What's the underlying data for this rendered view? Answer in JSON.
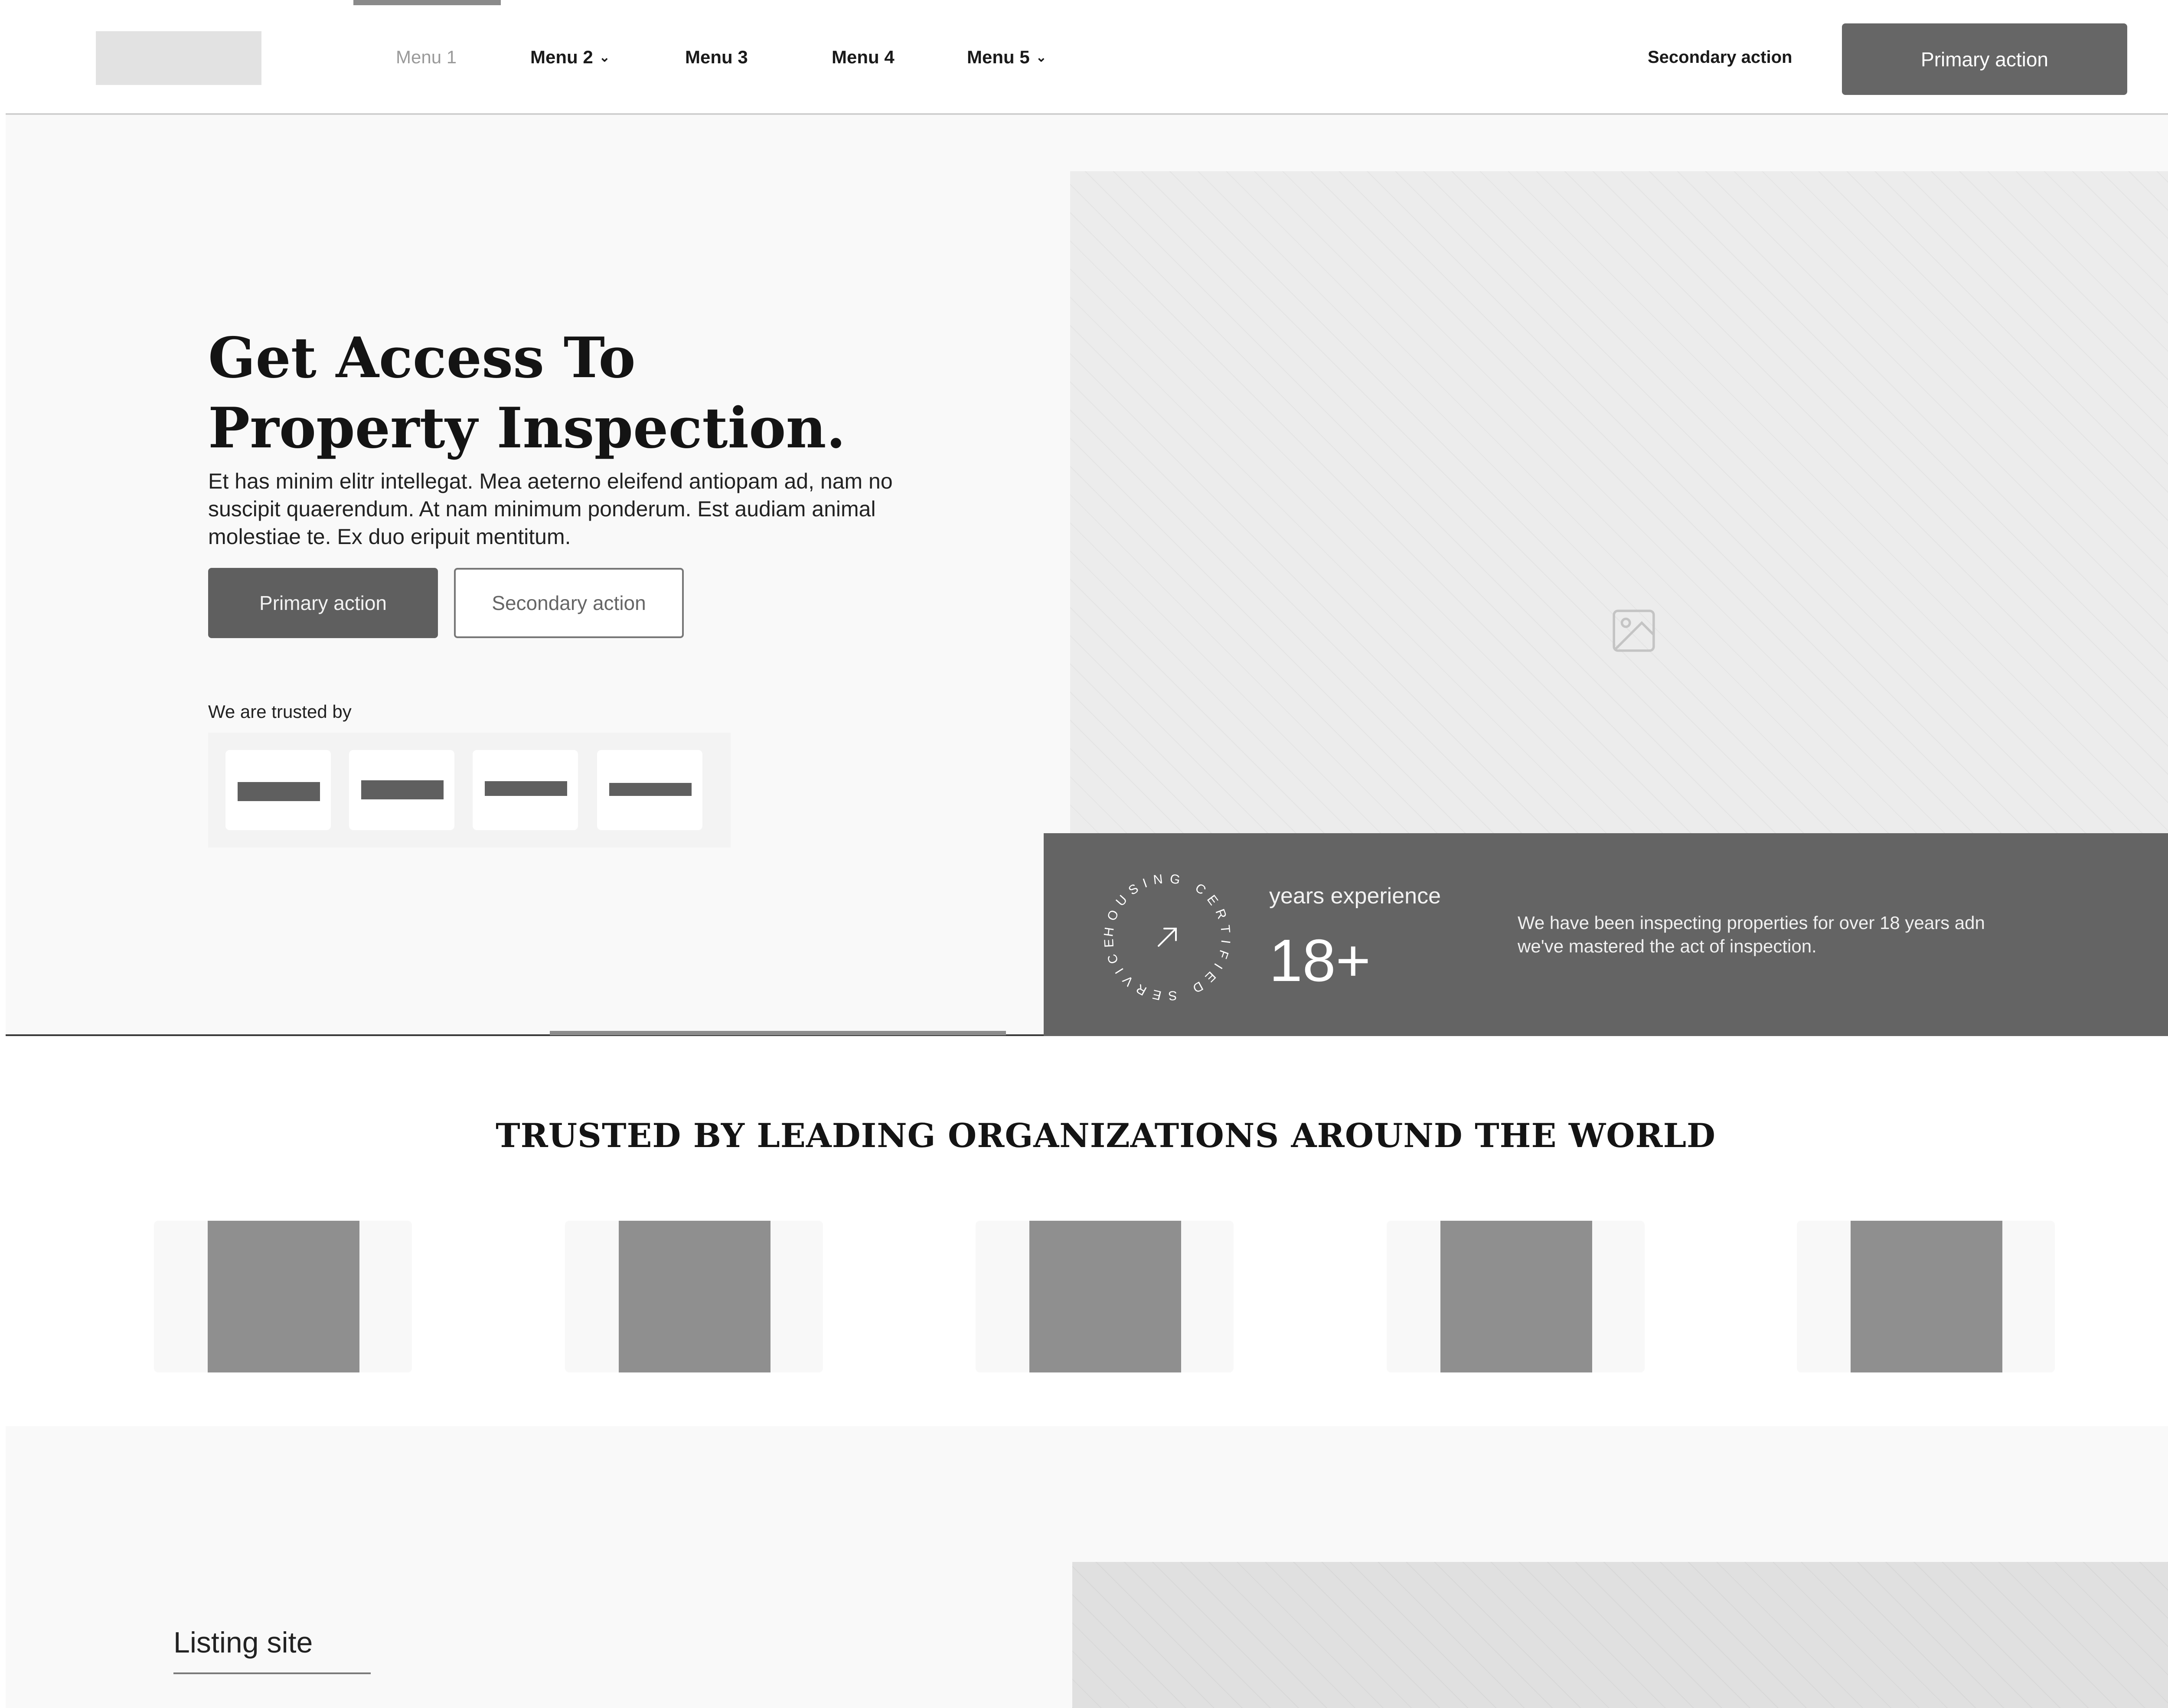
{
  "nav": {
    "menu_items": [
      {
        "label": "Menu 1",
        "active": true,
        "dropdown": false
      },
      {
        "label": "Menu 2",
        "active": false,
        "dropdown": true
      },
      {
        "label": "Menu 3",
        "active": false,
        "dropdown": false
      },
      {
        "label": "Menu 4",
        "active": false,
        "dropdown": false
      },
      {
        "label": "Menu 5",
        "active": false,
        "dropdown": true
      }
    ],
    "chevron_glyph": "⌄",
    "secondary_action": "Secondary action",
    "primary_action": "Primary action"
  },
  "hero": {
    "title_line1": "Get Access To",
    "title_line2": "Property Inspection.",
    "description": "Et has minim elitr intellegat. Mea aeterno eleifend antiopam ad, nam no suscipit quaerendum. At nam minimum ponderum. Est audiam animal molestiae te. Ex duo eripuit mentitum.",
    "primary_action": "Primary action",
    "secondary_action": "Secondary action",
    "trusted_label": "We are trusted by"
  },
  "stats": {
    "badge_text": "HOUSING CERTIFIED SERVICES",
    "badge_icon": "arrow-up-right-icon",
    "label": "years experience",
    "value": "18+",
    "description": "We have been inspecting properties for over 18 years adn we've mastered the act of inspection."
  },
  "orgs": {
    "heading": "TRUSTED BY LEADING ORGANIZATIONS AROUND THE WORLD"
  },
  "listing": {
    "title": "Listing site"
  },
  "colors": {
    "primary": "#666666",
    "stats_bg": "#646464",
    "placeholder": "#8f8f8f",
    "hero_bg": "#f9f9f9"
  }
}
